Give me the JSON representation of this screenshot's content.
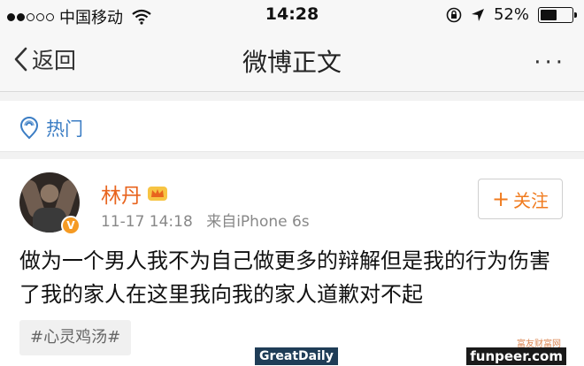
{
  "status_bar": {
    "carrier": "中国移动",
    "time": "14:28",
    "battery_text": "52%",
    "battery_level": 0.52
  },
  "nav": {
    "back_label": "返回",
    "title": "微博正文",
    "more_label": "···"
  },
  "hot_label": "热门",
  "post": {
    "author": "林丹",
    "verified_badge": "V",
    "date": "11-17 14:18",
    "source": "来自iPhone 6s",
    "follow_label": "关注",
    "follow_plus": "+",
    "content": "做为一个男人我不为自己做更多的辩解但是我的行为伤害了我的家人在这里我向我的家人道歉对不起",
    "tag": "#心灵鸡汤#"
  },
  "watermarks": {
    "left": "GreatDaily",
    "right": "funpeer.com",
    "corner": "富友财富网"
  },
  "colors": {
    "accent_orange": "#e8641e",
    "link_blue": "#3b7dc4"
  }
}
